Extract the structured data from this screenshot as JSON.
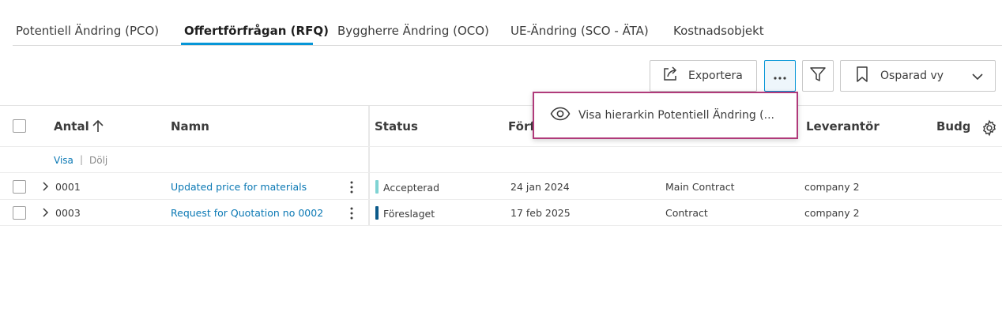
{
  "tabs": [
    {
      "label": "Potentiell Ändring (PCO)"
    },
    {
      "label": "Offertförfrågan (RFQ)"
    },
    {
      "label": "Byggherre Ändring (OCO)"
    },
    {
      "label": "UE-Ändring (SCO - ÄTA)"
    },
    {
      "label": "Kostnadsobjekt"
    }
  ],
  "active_tab": "Offertförfrågan (RFQ)",
  "toolbar": {
    "export_label": "Exportera",
    "view_label": "Osparad vy"
  },
  "menu": {
    "item_label": "Visa hierarkin Potentiell Ändring (..."
  },
  "table": {
    "headers": {
      "antal": "Antal",
      "namn": "Namn",
      "status": "Status",
      "forfa": "Förfa",
      "leverantor": "Leverantör",
      "budge": "Budge"
    },
    "sort_direction": "ascending",
    "subrow": {
      "visa": "Visa",
      "separator": "|",
      "dolj": "Dölj"
    },
    "rows": [
      {
        "antal": "0001",
        "namn": "Updated price for materials",
        "status": "Accepterad",
        "status_color": "#7fd3d3",
        "date": "24 jan 2024",
        "contract": "Main Contract",
        "supplier": "company 2"
      },
      {
        "antal": "0003",
        "namn": "Request for Quotation no 0002",
        "status": "Föreslaget",
        "status_color": "#0b5a8a",
        "date": "17 feb 2025",
        "contract": "Contract",
        "supplier": "company 2"
      }
    ]
  },
  "colors": {
    "accent": "#0696d7",
    "link": "#0a78b4",
    "menu_highlight": "#b03a7a"
  }
}
